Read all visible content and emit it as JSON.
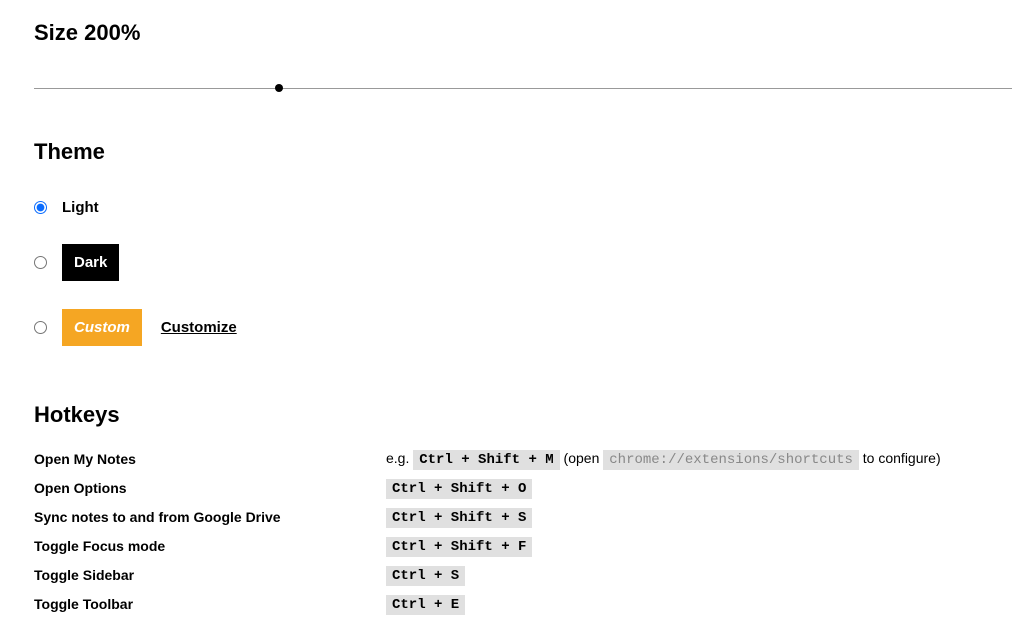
{
  "size": {
    "heading": "Size 200%",
    "percent": 25
  },
  "theme": {
    "heading": "Theme",
    "light_label": "Light",
    "dark_label": "Dark",
    "custom_label": "Custom",
    "customize_label": "Customize",
    "selected": "light"
  },
  "hotkeys": {
    "heading": "Hotkeys",
    "eg_prefix": "e.g. ",
    "eg_key": "Ctrl + Shift + M",
    "eg_open": " (open ",
    "eg_url": "chrome://extensions/shortcuts",
    "eg_close": " to configure)",
    "rows": [
      {
        "label": "Open My Notes",
        "key": ""
      },
      {
        "label": "Open Options",
        "key": "Ctrl + Shift + O"
      },
      {
        "label": "Sync notes to and from Google Drive",
        "key": "Ctrl + Shift + S"
      },
      {
        "label": "Toggle Focus mode",
        "key": "Ctrl + Shift + F"
      },
      {
        "label": "Toggle Sidebar",
        "key": "Ctrl + S"
      },
      {
        "label": "Toggle Toolbar",
        "key": "Ctrl + E"
      }
    ]
  }
}
